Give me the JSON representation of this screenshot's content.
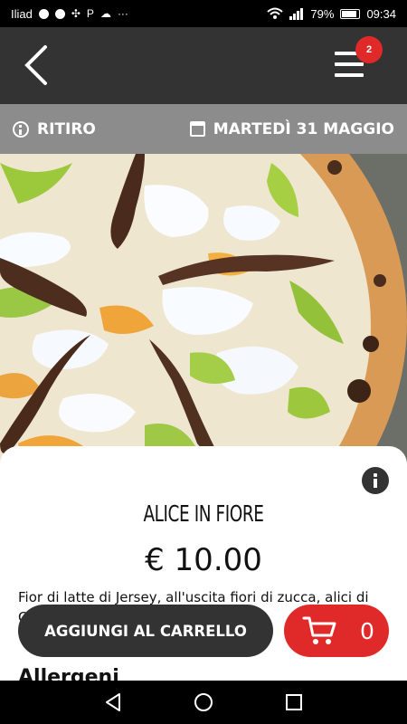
{
  "status_bar": {
    "carrier": "Iliad",
    "battery_text": "79%",
    "time": "09:34",
    "icons": [
      "opera-icon",
      "facebook-icon",
      "network-icon",
      "paypal-icon",
      "cloud-icon",
      "more-icon",
      "wifi-icon",
      "signal-icon",
      "battery-icon"
    ]
  },
  "header": {
    "back_icon": "chevron-left-icon",
    "menu_icon": "hamburger-icon",
    "cart_badge": "2"
  },
  "info_bar": {
    "mode_label": "RITIRO",
    "date_label": "MARTEDÌ 31 MAGGIO"
  },
  "product": {
    "image_subject": "pizza",
    "name": "ALICE IN FIORE",
    "price": "€ 10.00",
    "description": "Fior di latte di Jersey, all'uscita fiori di zucca, alici di Cetara, basilico",
    "allergens_title": "Allergeni"
  },
  "actions": {
    "add_to_cart_label": "AGGIUNGI AL CARRELLO",
    "cart_count": "0"
  },
  "navigation": {
    "items": [
      "back-nav-icon",
      "home-nav-icon",
      "recents-nav-icon"
    ]
  },
  "colors": {
    "header_background": "#333333",
    "info_bar_background": "#8c8c8c",
    "accent_red": "#e02a2a",
    "button_dark": "#333333"
  }
}
